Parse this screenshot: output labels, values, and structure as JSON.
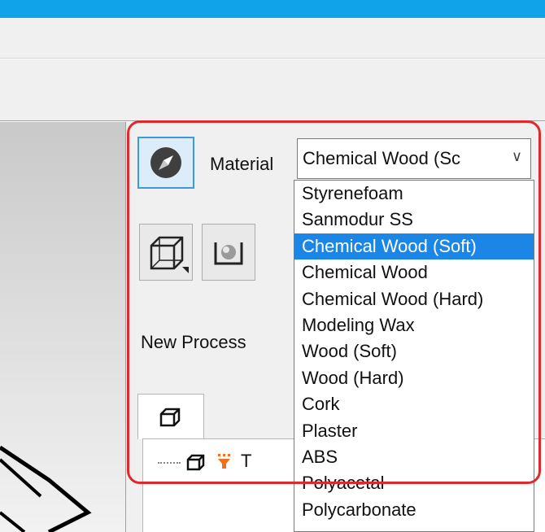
{
  "panel": {
    "material_label": "Material",
    "material_selected": "Chemical Wood (Sc",
    "material_options": [
      "Styrenefoam",
      "Sanmodur SS",
      "Chemical Wood (Soft)",
      "Chemical Wood",
      "Chemical Wood (Hard)",
      "Modeling Wax",
      "Wood (Soft)",
      "Wood (Hard)",
      "Cork",
      "Plaster",
      "ABS",
      "Polyacetal",
      "Polycarbonate"
    ],
    "highlighted_option_index": 2,
    "new_process_label": "New Process",
    "tree_row_text": "T"
  },
  "icons": {
    "material": "compass-icon",
    "wireframe": "cube-icon",
    "surface": "sphere-icon",
    "tab": "cube-icon",
    "filter": "filter-icon",
    "dropdown": "chevron-down-icon"
  },
  "colors": {
    "title_bar": "#11a3ea",
    "selection": "#1c86e6",
    "highlight_box": "#e0282d"
  }
}
